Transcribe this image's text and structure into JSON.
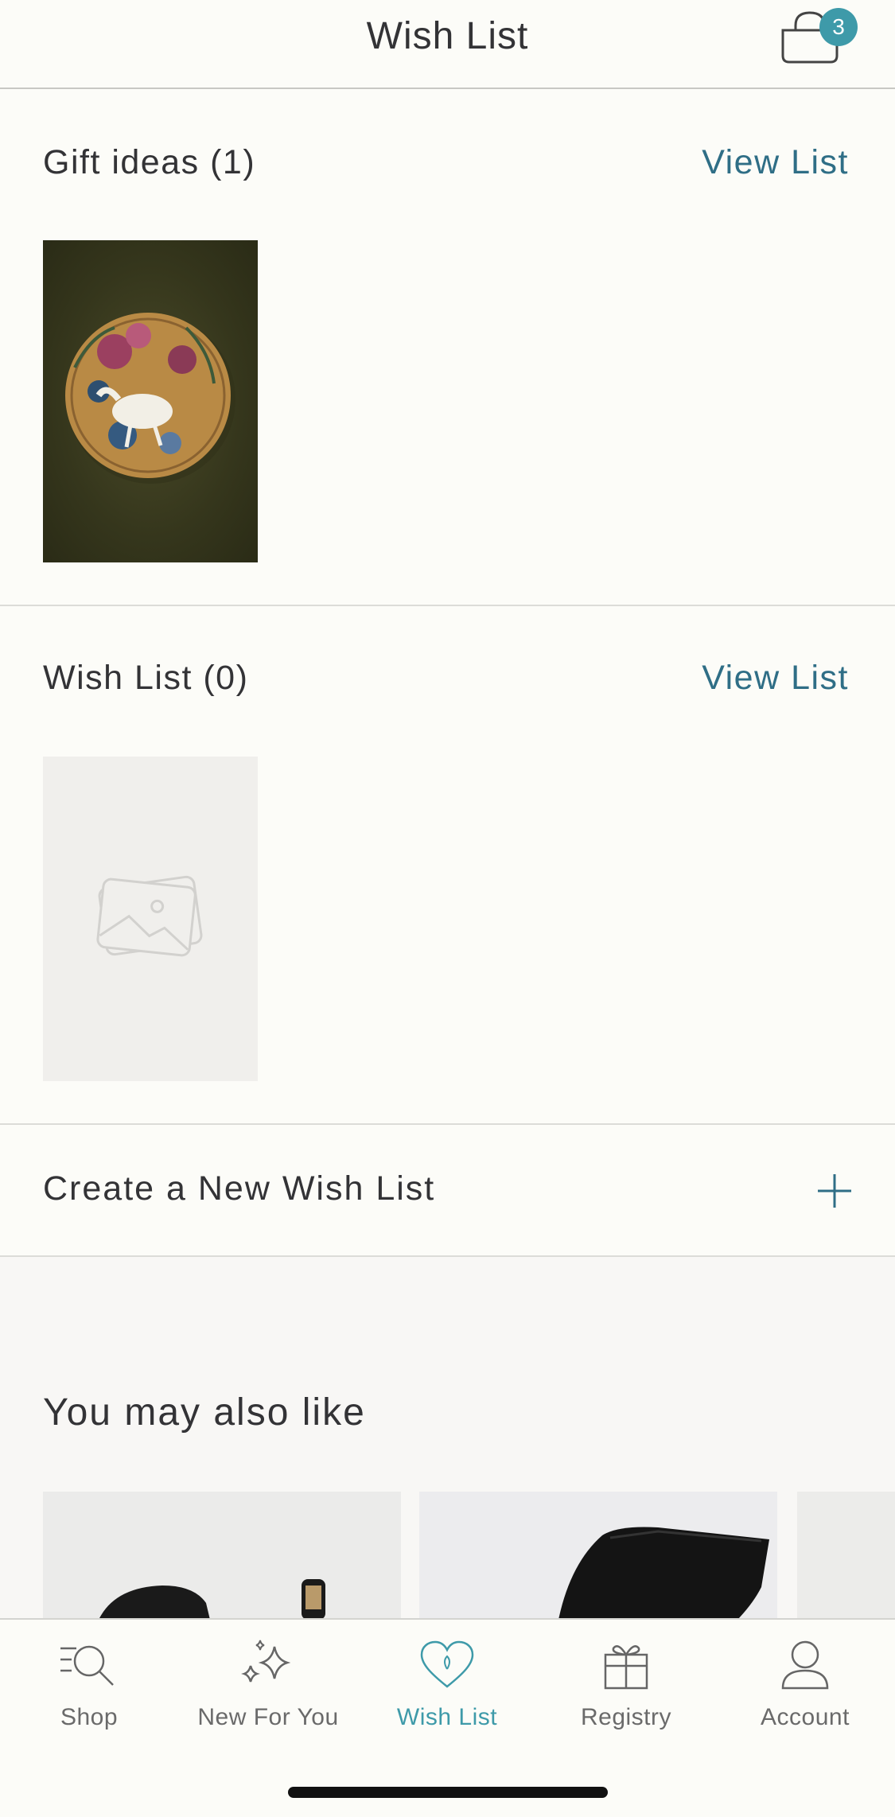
{
  "header": {
    "title": "Wish List",
    "cart_count": "3"
  },
  "lists": [
    {
      "title": "Gift ideas  (1)",
      "action": "View List"
    },
    {
      "title": "Wish List (0)",
      "action": "View List"
    }
  ],
  "create": {
    "label": "Create a New Wish List"
  },
  "recommendations": {
    "title": "You may also like"
  },
  "tabs": [
    {
      "label": "Shop",
      "icon": "search-menu-icon"
    },
    {
      "label": "New For You",
      "icon": "sparkle-icon"
    },
    {
      "label": "Wish List",
      "icon": "heart-icon",
      "active": true
    },
    {
      "label": "Registry",
      "icon": "gift-icon"
    },
    {
      "label": "Account",
      "icon": "person-icon"
    }
  ],
  "colors": {
    "accent": "#3e9aa9",
    "link": "#2f6e86",
    "background": "#fcfcf8"
  }
}
